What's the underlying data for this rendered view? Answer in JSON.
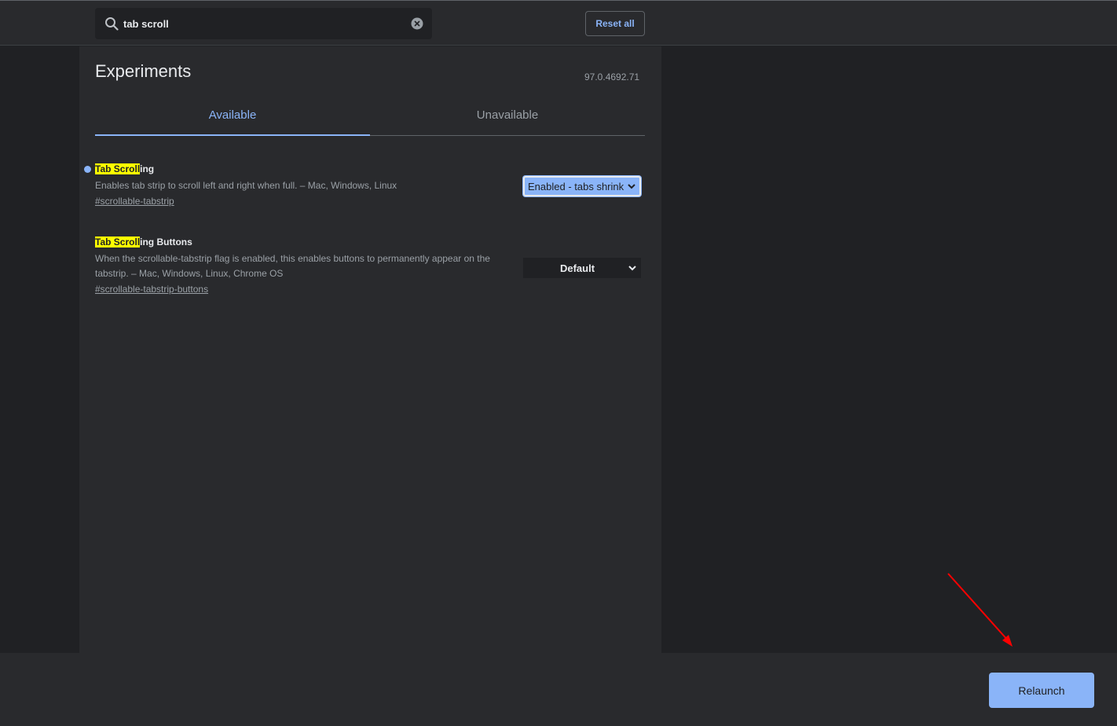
{
  "header": {
    "search_value": "tab scroll",
    "reset_label": "Reset all"
  },
  "main": {
    "title": "Experiments",
    "version": "97.0.4692.71",
    "tabs": [
      {
        "label": "Available",
        "active": true
      },
      {
        "label": "Unavailable",
        "active": false
      }
    ],
    "experiments": [
      {
        "title_highlight": "Tab Scroll",
        "title_rest": "ing",
        "description": "Enables tab strip to scroll left and right when full. – Mac, Windows, Linux",
        "link": "#scrollable-tabstrip",
        "selected": "Enabled - tabs shrink",
        "modified": true
      },
      {
        "title_highlight": "Tab Scroll",
        "title_rest": "ing Buttons",
        "description": "When the scrollable-tabstrip flag is enabled, this enables buttons to permanently appear on the tabstrip. – Mac, Windows, Linux, Chrome OS",
        "link": "#scrollable-tabstrip-buttons",
        "selected": "Default",
        "modified": false
      }
    ]
  },
  "footer": {
    "relaunch_label": "Relaunch"
  },
  "colors": {
    "accent": "#8ab4f8",
    "highlight": "#ffff00",
    "annotation_arrow": "#ff0000"
  },
  "icons": [
    "search-icon",
    "clear-icon",
    "chevron-down-icon"
  ]
}
